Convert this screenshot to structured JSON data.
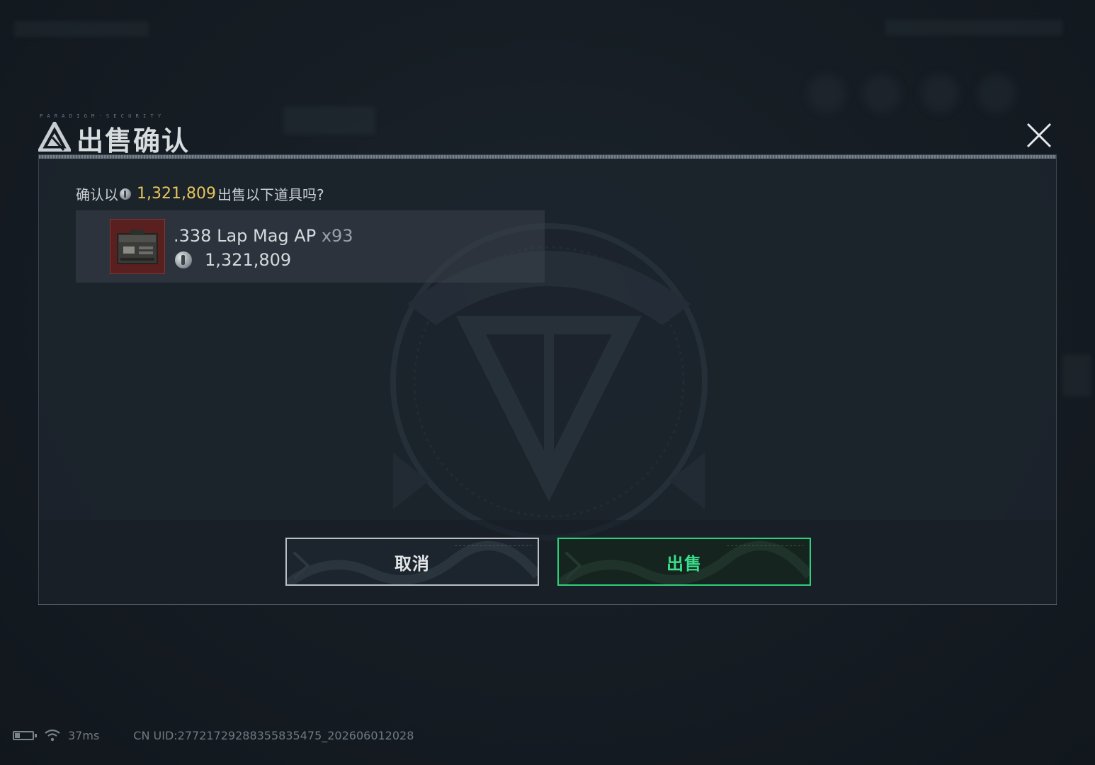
{
  "dialog": {
    "title": "出售确认",
    "header_tiny_text": "P A R A D I G M · S E C U R I T Y",
    "confirm_prefix": "确认以",
    "confirm_price": "1,321,809",
    "confirm_suffix": "出售以下道具吗?",
    "item": {
      "name": ".338 Lap Mag AP",
      "quantity": "x93",
      "price": "1,321,809",
      "icon": "ammo-box-icon"
    },
    "cancel_label": "取消",
    "sell_label": "出售"
  },
  "status_bar": {
    "battery_level": 0.3,
    "ping": "37ms",
    "uid": "CN UID:27721729288355835475_202606012028"
  },
  "colors": {
    "price_gold": "#e7c55a",
    "sell_green": "#2fd07a",
    "cancel_border": "#b9bfc3",
    "item_thumb_red": "#5a1f1f"
  }
}
